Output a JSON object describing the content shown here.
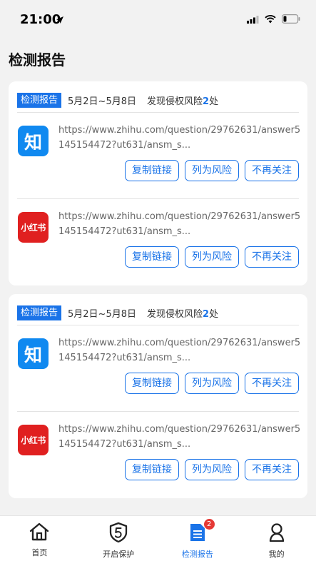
{
  "status": {
    "time": "21:00"
  },
  "page_title": "检测报告",
  "cards": [
    {
      "tag": "检测报告",
      "date_range": "5月2日~5月8日",
      "risk_prefix": "发现侵权风险",
      "risk_count": "2",
      "risk_suffix": "处",
      "entries": [
        {
          "icon_text": "知",
          "url": "https://www.zhihu.com/question/29762631/answer5145154472?ut631/ansm_s...",
          "buttons": [
            "复制链接",
            "列为风险",
            "不再关注"
          ]
        },
        {
          "icon_text": "小红书",
          "url": "https://www.zhihu.com/question/29762631/answer5145154472?ut631/ansm_s...",
          "buttons": [
            "复制链接",
            "列为风险",
            "不再关注"
          ]
        }
      ]
    },
    {
      "tag": "检测报告",
      "date_range": "5月2日~5月8日",
      "risk_prefix": "发现侵权风险",
      "risk_count": "2",
      "risk_suffix": "处",
      "entries": [
        {
          "icon_text": "知",
          "url": "https://www.zhihu.com/question/29762631/answer5145154472?ut631/ansm_s...",
          "buttons": [
            "复制链接",
            "列为风险",
            "不再关注"
          ]
        },
        {
          "icon_text": "小红书",
          "url": "https://www.zhihu.com/question/29762631/answer5145154472?ut631/ansm_s...",
          "buttons": [
            "复制链接",
            "列为风险",
            "不再关注"
          ]
        }
      ]
    }
  ],
  "tabbar": {
    "items": [
      {
        "label": "首页",
        "icon": "home-icon"
      },
      {
        "label": "开启保护",
        "icon": "shield-icon"
      },
      {
        "label": "检测报告",
        "icon": "report-icon",
        "badge": "2"
      },
      {
        "label": "我的",
        "icon": "profile-icon"
      }
    ],
    "active": "检测报告"
  },
  "colors": {
    "accent": "#1a73e8",
    "zhihu": "#1089f0",
    "xiaohongshu": "#e02020",
    "badge": "#e53935"
  }
}
